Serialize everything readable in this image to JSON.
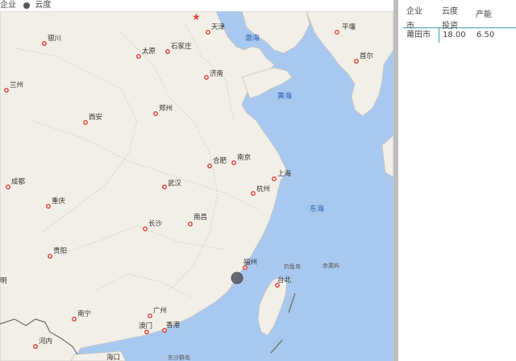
{
  "legend": {
    "field": "企业",
    "series": "云度"
  },
  "table": {
    "headers": [
      {
        "line1": "企业",
        "line2": "市"
      },
      {
        "line1": "云度",
        "line2": "投资"
      },
      {
        "line1": "",
        "line2": "产能"
      }
    ],
    "rows": [
      {
        "city": "莆田市",
        "invest": "18.00",
        "capacity": "6.50"
      }
    ]
  },
  "map": {
    "colors": {
      "land": "#f2efe9",
      "sea": "#a9c8ef",
      "border": "#c8c3bb",
      "city_dot": "#e0463c",
      "marker": "#5c5f66"
    },
    "cities": {
      "tianjin": "天津",
      "yinchuan": "银川",
      "taiyuan": "太原",
      "shijiazhuang": "石家庄",
      "jinan": "济南",
      "lanzhou": "兰州",
      "xian": "西安",
      "zhengzhou": "郑州",
      "hefei": "合肥",
      "nanjing": "南京",
      "shanghai": "上海",
      "chengdu": "成都",
      "wuhan": "武汉",
      "hangzhou": "杭州",
      "chongqing": "重庆",
      "changsha": "长沙",
      "nanchang": "南昌",
      "guiyang": "贵阳",
      "fuzhou": "福州",
      "taibei": "台北",
      "nanning": "南宁",
      "guangzhou": "广州",
      "aomen": "澳门",
      "xianggang": "香港",
      "pingrang": "平壤",
      "shouer": "首尔",
      "hanoi": "河内",
      "kunming_partial": "明"
    },
    "seas": {
      "bohai": "渤海",
      "huanghai": "黄海",
      "donghai": "东海"
    },
    "islands": {
      "diaoyu": "钓鱼岛",
      "chiwei": "赤尾屿",
      "dongsha": "东沙群岛",
      "haikou_partial": "海口"
    }
  }
}
